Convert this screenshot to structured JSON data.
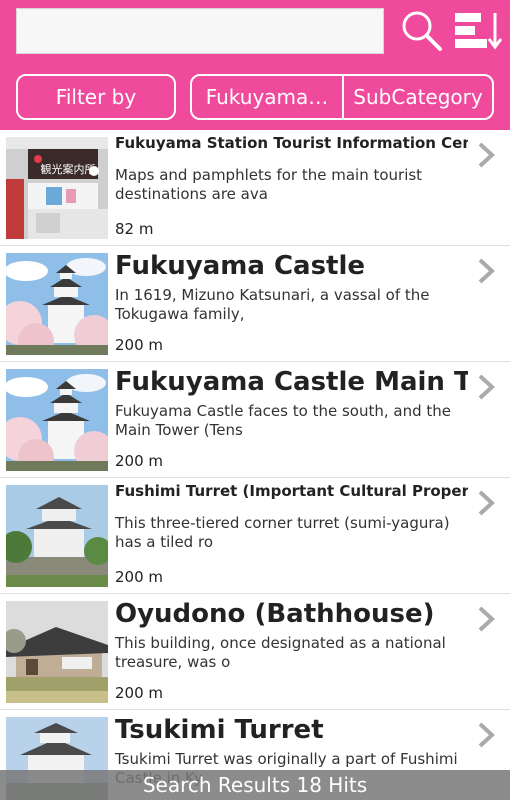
{
  "search": {
    "placeholder": "",
    "value": ""
  },
  "toolbar": {
    "search_icon": "search-icon",
    "sort_icon": "sort-icon"
  },
  "filters": {
    "filter_label": "Filter by",
    "category_label": "Fukuyama…",
    "subcategory_label": "SubCategory"
  },
  "results": [
    {
      "title": "Fukuyama Station Tourist Information Center",
      "description": "Maps and pamphlets for the main tourist destinations are ava",
      "distance": "82 m",
      "sign": "観光案内所"
    },
    {
      "title": "Fukuyama Castle",
      "description": "In 1619, Mizuno Katsunari, a vassal of the Tokugawa family,",
      "distance": "200 m"
    },
    {
      "title": "Fukuyama Castle Main Tower",
      "description": "Fukuyama Castle faces to the south, and the Main Tower (Tens",
      "distance": "200 m"
    },
    {
      "title": "Fushimi Turret (Important Cultural Property)",
      "description": "This three-tiered corner turret (sumi-yagura) has a tiled ro",
      "distance": "200 m"
    },
    {
      "title": "Oyudono (Bathhouse)",
      "description": "This building, once designated as a national treasure, was o",
      "distance": "200 m"
    },
    {
      "title": "Tsukimi Turret",
      "description": "Tsukimi Turret was originally a part of Fushimi Castle in Ky",
      "distance": ""
    }
  ],
  "footer": {
    "status": "Search Results 18 Hits"
  },
  "colors": {
    "header": "#f04a9c",
    "footer_bg": "#787878"
  }
}
